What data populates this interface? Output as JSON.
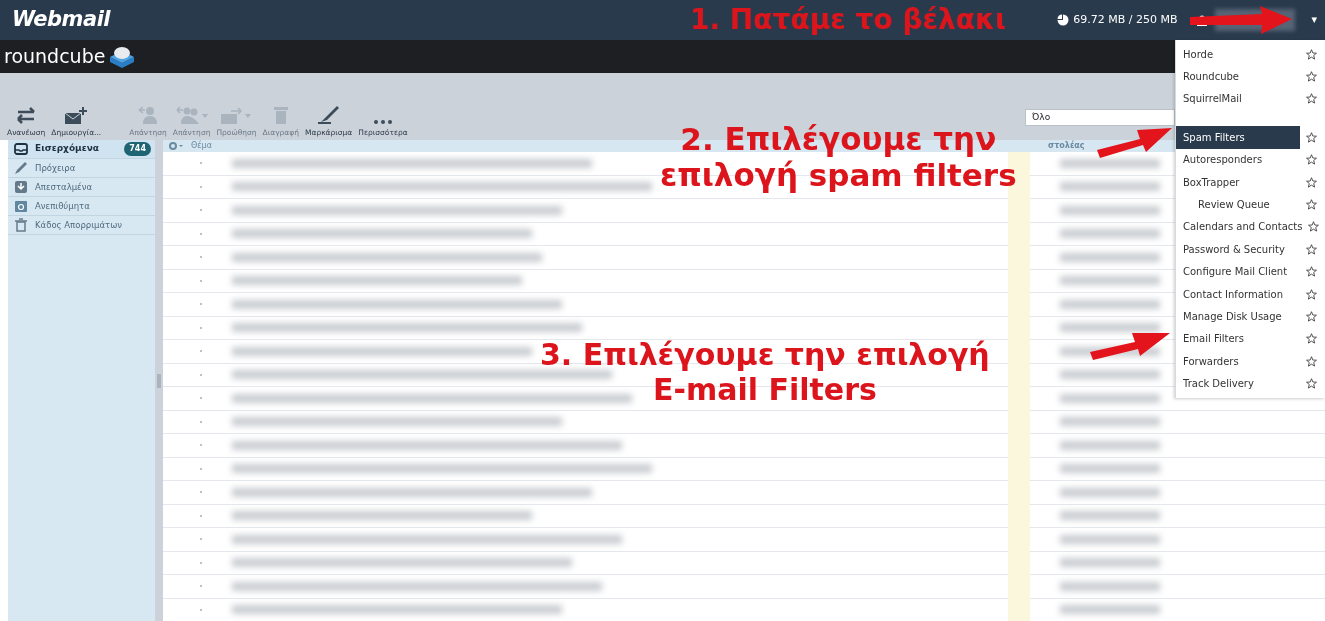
{
  "topbar": {
    "logo": "Webmail",
    "quota": "69.72 MB / 250 MB",
    "menu_caret": "▾"
  },
  "roundcube_bar": {
    "logo": "roundcube"
  },
  "toolbar": [
    {
      "label": "Ανανέωση",
      "kind": "refresh",
      "disabled": false
    },
    {
      "label": "Δημιουργία...",
      "kind": "compose",
      "disabled": false
    },
    {
      "label": "Απάντηση",
      "kind": "reply",
      "disabled": true
    },
    {
      "label": "Απάντηση",
      "kind": "reply-all",
      "disabled": true
    },
    {
      "label": "Προώθηση",
      "kind": "forward",
      "disabled": true
    },
    {
      "label": "Διαγραφή",
      "kind": "delete",
      "disabled": true
    },
    {
      "label": "Μαρκάρισμα",
      "kind": "mark",
      "disabled": false
    },
    {
      "label": "Περισσότερα",
      "kind": "more",
      "disabled": false
    }
  ],
  "search": {
    "value": "Όλο"
  },
  "folders": [
    {
      "name": "Εισερχόμενα",
      "kind": "inbox",
      "count": "744",
      "selected": true
    },
    {
      "name": "Πρόχειρα",
      "kind": "drafts",
      "selected": false
    },
    {
      "name": "Απεσταλμένα",
      "kind": "sent",
      "selected": false
    },
    {
      "name": "Ανεπιθύμητα",
      "kind": "junk",
      "selected": false
    },
    {
      "name": "Κάδος Απορριμάτων",
      "kind": "trash",
      "selected": false
    }
  ],
  "message_list": {
    "columns": [
      "Θέμα",
      "στολέας"
    ]
  },
  "dropdown_menu": {
    "sections": [
      [
        {
          "label": "Horde",
          "selected": false
        },
        {
          "label": "Roundcube",
          "selected": false
        },
        {
          "label": "SquirrelMail",
          "selected": false
        }
      ],
      [
        {
          "label": "Spam Filters",
          "selected": true
        },
        {
          "label": "Autoresponders",
          "selected": false
        },
        {
          "label": "BoxTrapper",
          "selected": false,
          "children": [
            {
              "label": "Review Queue",
              "selected": false
            }
          ]
        },
        {
          "label": "Calendars and Contacts",
          "selected": false
        },
        {
          "label": "Password & Security",
          "selected": false
        },
        {
          "label": "Configure Mail Client",
          "selected": false
        },
        {
          "label": "Contact Information",
          "selected": false
        },
        {
          "label": "Manage Disk Usage",
          "selected": false
        },
        {
          "label": "Email Filters",
          "selected": false
        },
        {
          "label": "Forwarders",
          "selected": false
        },
        {
          "label": "Track Delivery",
          "selected": false
        }
      ]
    ]
  },
  "annotations": [
    {
      "lines": [
        "1. Πατάμε το βέλακι"
      ]
    },
    {
      "lines": [
        "2. Επιλέγουμε την",
        "επιλογή spam filters"
      ]
    },
    {
      "lines": [
        "3. Επιλέγουμε την επιλογή",
        "E-mail Filters"
      ]
    }
  ]
}
